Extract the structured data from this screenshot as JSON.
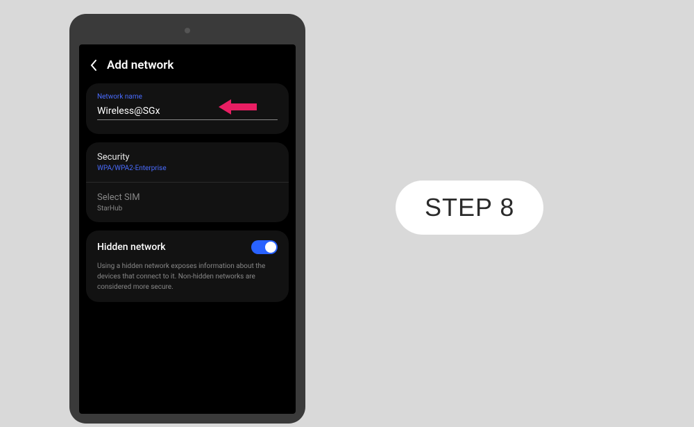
{
  "header": {
    "title": "Add network"
  },
  "network_name": {
    "label": "Network name",
    "value": "Wireless@SGx"
  },
  "security": {
    "title": "Security",
    "value": "WPA/WPA2-Enterprise"
  },
  "sim": {
    "title": "Select SIM",
    "value": "StarHub"
  },
  "hidden_network": {
    "title": "Hidden network",
    "toggle_state": "on",
    "description": "Using a hidden network exposes information about the devices that connect to it. Non-hidden networks are considered more secure."
  },
  "step_badge": "STEP 8",
  "colors": {
    "accent_blue": "#4a6cff",
    "toggle_blue": "#2962ff",
    "arrow_pink": "#e91e63"
  }
}
